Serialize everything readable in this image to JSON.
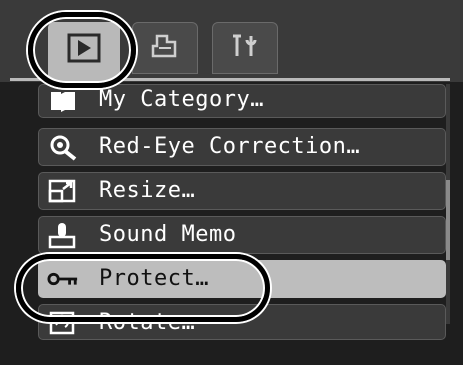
{
  "tabs": [
    {
      "name": "play",
      "icon": "play-icon"
    },
    {
      "name": "print",
      "icon": "print-icon"
    },
    {
      "name": "setup",
      "icon": "wrench-icon"
    }
  ],
  "menu": {
    "items": [
      {
        "label": "My Category…",
        "icon": "book-icon"
      },
      {
        "label": "Red-Eye Correction…",
        "icon": "eye-correction-icon"
      },
      {
        "label": "Resize…",
        "icon": "resize-icon"
      },
      {
        "label": "Sound Memo",
        "icon": "microphone-icon"
      },
      {
        "label": "Protect…",
        "icon": "key-icon"
      },
      {
        "label": "Rotate…",
        "icon": "rotate-icon"
      }
    ],
    "selected": "Protect…"
  },
  "colors": {
    "screen_bg": "#1e1e1e",
    "row_bg": "#3a3a3a",
    "selected_bg": "#bdbdbd",
    "text": "#ffffff"
  }
}
